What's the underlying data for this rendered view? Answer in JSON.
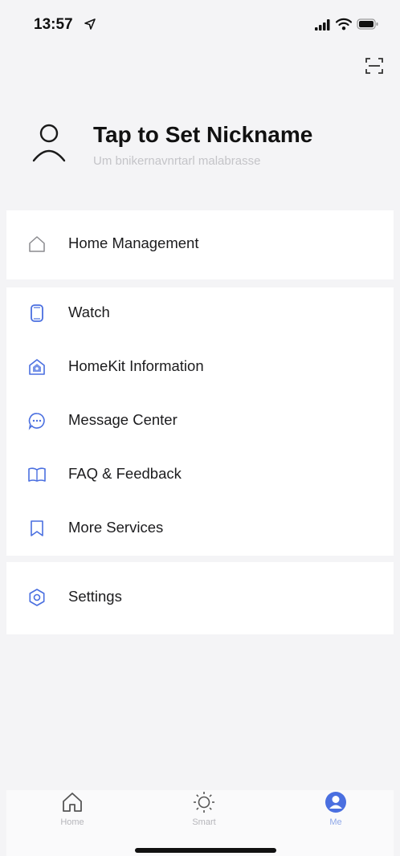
{
  "status_bar": {
    "time": "13:57",
    "icons": [
      "location-arrow-icon",
      "cellular-signal-icon",
      "wifi-icon",
      "battery-icon"
    ]
  },
  "header": {
    "scan_icon": "scan-icon"
  },
  "profile": {
    "nickname": "Tap to Set Nickname",
    "subtitle": "Um bnikernavnrtarl malabrasse",
    "avatar_icon": "person-icon"
  },
  "menu": {
    "group1": [
      {
        "label": "Home Management",
        "icon": "home-outline-icon"
      }
    ],
    "group2": [
      {
        "label": "Watch",
        "icon": "watch-icon"
      },
      {
        "label": "HomeKit Information",
        "icon": "homekit-icon"
      },
      {
        "label": "Message Center",
        "icon": "message-bubble-icon"
      },
      {
        "label": "FAQ & Feedback",
        "icon": "book-icon"
      },
      {
        "label": "More Services",
        "icon": "bookmark-icon"
      }
    ],
    "group3": [
      {
        "label": "Settings",
        "icon": "gear-icon"
      }
    ]
  },
  "tab_bar": {
    "tabs": [
      {
        "label": "Home",
        "icon": "home-tab-icon",
        "active": false
      },
      {
        "label": "Smart",
        "icon": "sun-icon",
        "active": false
      },
      {
        "label": "Me",
        "icon": "profile-tab-icon",
        "active": true
      }
    ]
  },
  "colors": {
    "accent": "#4a6fe0",
    "background": "#f4f4f6",
    "card": "#ffffff",
    "inactive_tab": "#b5b5ba"
  }
}
